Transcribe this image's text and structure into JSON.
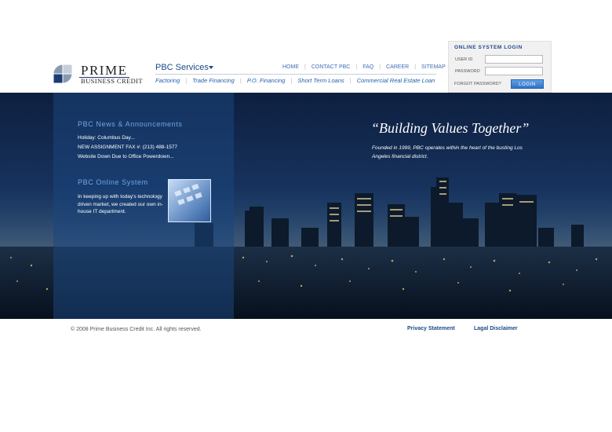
{
  "logo": {
    "name": "PRIME",
    "subtitle": "BUSINESS CREDIT"
  },
  "services": {
    "title": "PBC Services",
    "items": [
      "Factoring",
      "Trade Financing",
      "P.O. Financing",
      "Short Term Loans",
      "Commercial Real Estate Loan"
    ]
  },
  "top_nav": [
    "HOME",
    "CONTACT PBC",
    "FAQ",
    "CAREER",
    "SITEMAP"
  ],
  "login": {
    "title": "ONLINE SYSTEM LOGIN",
    "user_label": "USER ID",
    "password_label": "PASSWORD",
    "forgot": "FORGOT PASSWORD?",
    "button": "LOGIN"
  },
  "news": {
    "title": "PBC News & Announcements",
    "items": [
      "Holiday: Columbus Day...",
      "NEW ASSIGNMENT FAX #: (213) 488-1577",
      "Website Down Due to Office Powerdown..."
    ]
  },
  "online_system": {
    "title": "PBC Online System",
    "text": "In keeping up with today's technology driven market, we created our own in-house IT department."
  },
  "hero": {
    "tagline": "“Building Values Together”",
    "subtext": "Founded in 1999, PBC operates within the heart  of the busting Los Angeles financial district."
  },
  "footer": {
    "copyright": "© 2008 Prime Business Credit Inc. All rights reserved.",
    "privacy": "Privacy Statement",
    "legal": "Lagal Disclaimer"
  },
  "colors": {
    "accent": "#1b4a8a",
    "link": "#3f6fb5",
    "hero_dark": "#0d1f3f"
  }
}
